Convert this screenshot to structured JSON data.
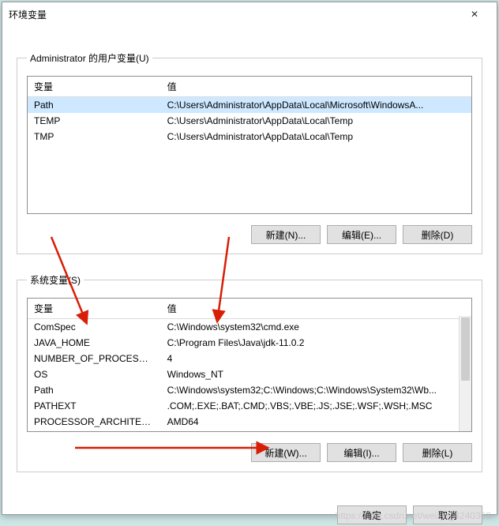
{
  "window": {
    "title": "环境变量"
  },
  "userGroup": {
    "legend": "Administrator 的用户变量(U)",
    "headers": {
      "var": "变量",
      "val": "值"
    },
    "rows": [
      {
        "var": "Path",
        "val": "C:\\Users\\Administrator\\AppData\\Local\\Microsoft\\WindowsA...",
        "selected": true
      },
      {
        "var": "TEMP",
        "val": "C:\\Users\\Administrator\\AppData\\Local\\Temp"
      },
      {
        "var": "TMP",
        "val": "C:\\Users\\Administrator\\AppData\\Local\\Temp"
      }
    ],
    "buttons": {
      "new": "新建(N)...",
      "edit": "编辑(E)...",
      "del": "删除(D)"
    }
  },
  "sysGroup": {
    "legend": "系统变量(S)",
    "headers": {
      "var": "变量",
      "val": "值"
    },
    "rows": [
      {
        "var": "ComSpec",
        "val": "C:\\Windows\\system32\\cmd.exe"
      },
      {
        "var": "JAVA_HOME",
        "val": "C:\\Program Files\\Java\\jdk-11.0.2"
      },
      {
        "var": "NUMBER_OF_PROCESSORS",
        "val": "4"
      },
      {
        "var": "OS",
        "val": "Windows_NT"
      },
      {
        "var": "Path",
        "val": "C:\\Windows\\system32;C:\\Windows;C:\\Windows\\System32\\Wb..."
      },
      {
        "var": "PATHEXT",
        "val": ".COM;.EXE;.BAT;.CMD;.VBS;.VBE;.JS;.JSE;.WSF;.WSH;.MSC"
      },
      {
        "var": "PROCESSOR_ARCHITECT...",
        "val": "AMD64"
      }
    ],
    "buttons": {
      "new": "新建(W)...",
      "edit": "编辑(I)...",
      "del": "删除(L)"
    }
  },
  "footer": {
    "ok": "确定",
    "cancel": "取消"
  },
  "watermark": "https://blog.csdn.net/weixin_4240363"
}
